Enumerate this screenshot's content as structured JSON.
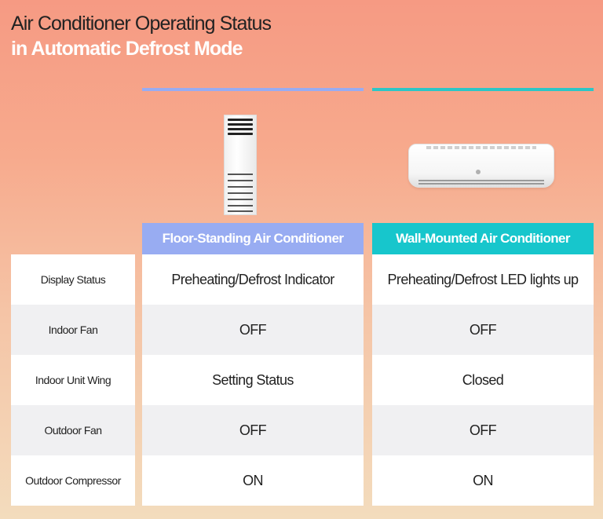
{
  "title": {
    "line1": "Air Conditioner Operating Status",
    "line2": "in Automatic Defrost Mode"
  },
  "colors": {
    "floor_accent": "#98acf2",
    "wall_accent": "#17c6cc"
  },
  "columns": [
    {
      "label": "Floor-Standing Air Conditioner",
      "image": "floor-standing-ac-unit"
    },
    {
      "label": "Wall-Mounted Air Conditioner",
      "image": "wall-mounted-ac-unit"
    }
  ],
  "rows": [
    {
      "label": "Display Status",
      "floor": "Preheating/Defrost Indicator",
      "wall": "Preheating/Defrost LED lights up"
    },
    {
      "label": "Indoor Fan",
      "floor": "OFF",
      "wall": "OFF"
    },
    {
      "label": "Indoor Unit Wing",
      "floor": "Setting Status",
      "wall": "Closed"
    },
    {
      "label": "Outdoor Fan",
      "floor": "OFF",
      "wall": "OFF"
    },
    {
      "label": "Outdoor Compressor",
      "floor": "ON",
      "wall": "ON"
    }
  ]
}
